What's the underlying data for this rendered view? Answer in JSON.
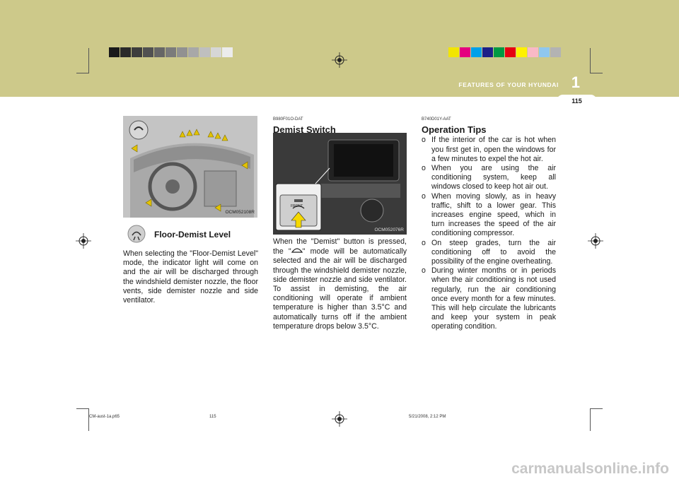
{
  "header": {
    "chapter_title": "FEATURES OF YOUR HYUNDAI",
    "chapter_number": "1",
    "page_number": "115",
    "left_swatches": [
      "#1a1a1a",
      "#2a2a2a",
      "#3d3d3d",
      "#515151",
      "#666666",
      "#7b7b7b",
      "#919191",
      "#a8a8a8",
      "#bfbfbf",
      "#d6d6d6",
      "#ececec"
    ],
    "right_swatches": [
      "#f2e500",
      "#e4007f",
      "#00a0e9",
      "#1d2088",
      "#009944",
      "#e60012",
      "#fff100",
      "#f9b9c6",
      "#8fc7ee",
      "#b3b3b3"
    ]
  },
  "left_column": {
    "figure_code": "OCM052108R",
    "mode_heading": "Floor-Demist Level",
    "body": "When selecting the \"Floor-Demist Level\" mode, the indicator light will come on and the air will be discharged through the windshield demister nozzle, the floor vents, side demister nozzle and side ventilator."
  },
  "middle_column": {
    "section_code": "B980F01O-DAT",
    "heading": "Demist Switch",
    "figure_code": "OCM052076R",
    "button_label": "FRONT",
    "body_part1": "When the \"Demist\" button is pressed, the \"",
    "body_part2": "\" mode will be automatically selected and the air will be discharged through the windshield demister nozzle, side demister nozzle and side ventilator. To assist in demisting, the air conditioning will operate if ambient temperature is higher than 3.5°C and automatically turns off if the ambient temperature drops below 3.5°C."
  },
  "right_column": {
    "section_code": "B740D01Y-AAT",
    "heading": "Operation Tips",
    "bullet": "o",
    "tips": [
      "If the interior of the car is hot when you first get in, open the windows for a few minutes to expel the hot air.",
      "When you are using the air conditioning system, keep all windows closed to keep hot air out.",
      "When moving slowly, as in heavy traffic, shift to a lower gear. This increases engine speed, which in turn increases the speed of the air conditioning compressor.",
      "On steep grades, turn the air conditioning off to avoid the possibility of the engine overheating.",
      "During winter months or in periods when the air conditioning is not used regularly, run the air conditioning once every month for a few minutes. This will help circulate the lubricants and keep your system in peak operating condition."
    ]
  },
  "footer": {
    "file_name": "CM-aust-1a.p65",
    "page": "115",
    "timestamp": "5/21/2008, 2:12 PM"
  },
  "watermark": "carmanualsonline.info"
}
